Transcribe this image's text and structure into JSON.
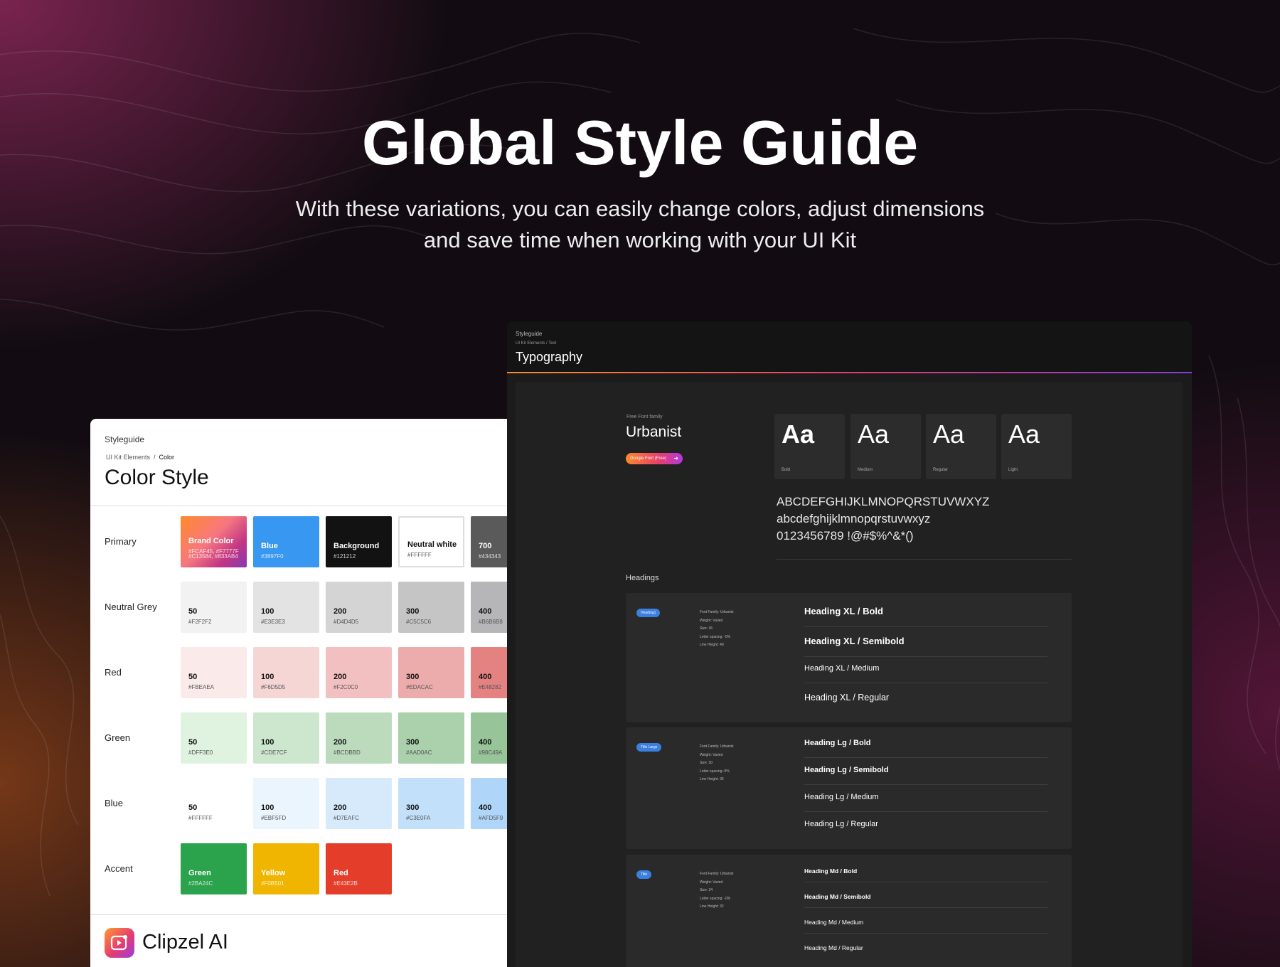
{
  "hero": {
    "title": "Global Style Guide",
    "subtitle_line1": "With these variations, you can easily change colors, adjust dimensions",
    "subtitle_line2": "and save time when working with your UI Kit"
  },
  "color_panel": {
    "crumb_top": "Styleguide",
    "breadcrumb_parent": "UI Kit Elements",
    "breadcrumb_sep": "/",
    "breadcrumb_current": "Color",
    "title": "Color Style",
    "rows": [
      {
        "label": "Primary",
        "swatches": [
          {
            "name": "Brand Color",
            "hex": "#FCAF45, #F7777F",
            "hex2": "#C13584, #833AB4",
            "bg": "gradient",
            "tone": "dark"
          },
          {
            "name": "Blue",
            "hex": "#3897F0",
            "bg": "#3897F0",
            "tone": "dark"
          },
          {
            "name": "Background",
            "hex": "#121212",
            "bg": "#121212",
            "tone": "dark"
          },
          {
            "name": "Neutral white",
            "hex": "#FFFFFF",
            "bg": "#FFFFFF",
            "tone": "lite",
            "border": true
          },
          {
            "name": "700",
            "hex": "#434343",
            "bg": "#5a5a5a",
            "tone": "dark"
          }
        ]
      },
      {
        "label": "Neutral Grey",
        "swatches": [
          {
            "name": "50",
            "hex": "#F2F2F2",
            "bg": "#F2F2F2",
            "tone": "lite"
          },
          {
            "name": "100",
            "hex": "#E3E3E3",
            "bg": "#E3E3E3",
            "tone": "lite"
          },
          {
            "name": "200",
            "hex": "#D4D4D5",
            "bg": "#D4D4D5",
            "tone": "lite"
          },
          {
            "name": "300",
            "hex": "#C5C5C6",
            "bg": "#C5C5C6",
            "tone": "lite"
          },
          {
            "name": "400",
            "hex": "#B6B6B8",
            "bg": "#B6B6B8",
            "tone": "lite"
          }
        ]
      },
      {
        "label": "Red",
        "swatches": [
          {
            "name": "50",
            "hex": "#FBEAEA",
            "bg": "#FBEAEA",
            "tone": "lite"
          },
          {
            "name": "100",
            "hex": "#F6D5D5",
            "bg": "#F6D5D5",
            "tone": "lite"
          },
          {
            "name": "200",
            "hex": "#F2C0C0",
            "bg": "#F2C0C0",
            "tone": "lite"
          },
          {
            "name": "300",
            "hex": "#EDACAC",
            "bg": "#EDACAC",
            "tone": "lite"
          },
          {
            "name": "400",
            "hex": "#E48282",
            "bg": "#E48282",
            "tone": "lite"
          }
        ]
      },
      {
        "label": "Green",
        "swatches": [
          {
            "name": "50",
            "hex": "#DFF3E0",
            "bg": "#DFF3E0",
            "tone": "lite"
          },
          {
            "name": "100",
            "hex": "#CDE7CF",
            "bg": "#CDE7CF",
            "tone": "lite"
          },
          {
            "name": "200",
            "hex": "#BCDBBD",
            "bg": "#BCDBBD",
            "tone": "lite"
          },
          {
            "name": "300",
            "hex": "#AAD0AC",
            "bg": "#AAD0AC",
            "tone": "lite"
          },
          {
            "name": "400",
            "hex": "#98C49A",
            "bg": "#98C49A",
            "tone": "lite"
          }
        ]
      },
      {
        "label": "Blue",
        "swatches": [
          {
            "name": "50",
            "hex": "#FFFFFF",
            "bg": "#FFFFFF",
            "tone": "lite"
          },
          {
            "name": "100",
            "hex": "#EBF5FD",
            "bg": "#EBF5FD",
            "tone": "lite"
          },
          {
            "name": "200",
            "hex": "#D7EAFC",
            "bg": "#D7EAFC",
            "tone": "lite"
          },
          {
            "name": "300",
            "hex": "#C3E0FA",
            "bg": "#C3E0FA",
            "tone": "lite"
          },
          {
            "name": "400",
            "hex": "#AFD5F9",
            "bg": "#AFD5F9",
            "tone": "lite"
          }
        ]
      },
      {
        "label": "Accent",
        "swatches": [
          {
            "name": "Green",
            "hex": "#2BA24C",
            "bg": "#2BA24C",
            "tone": "dark"
          },
          {
            "name": "Yellow",
            "hex": "#F0B501",
            "bg": "#F0B501",
            "tone": "dark"
          },
          {
            "name": "Red",
            "hex": "#E43E2B",
            "bg": "#E43E2B",
            "tone": "dark"
          }
        ]
      }
    ],
    "brand_name": "Clipzel AI",
    "brand_logo_icon": "play-video-icon"
  },
  "typo_panel": {
    "crumb_top": "Styleguide",
    "breadcrumb": "UI Kit Elements  /  Text",
    "title": "Typography",
    "font_family_label": "Free Font family",
    "font_name": "Urbanist",
    "font_badge": "Google Font (Free)",
    "weights": [
      {
        "sample": "Aa",
        "label": "Bold",
        "weight": "bold"
      },
      {
        "sample": "Aa",
        "label": "Medium",
        "weight": "normal"
      },
      {
        "sample": "Aa",
        "label": "Regular",
        "weight": "normal"
      },
      {
        "sample": "Aa",
        "label": "Light",
        "weight": "normal"
      }
    ],
    "alphabet_upper": "ABCDEFGHIJKLMNOPQRSTUVWXYZ",
    "alphabet_lower": "abcdefghijklmnopqrstuvwxyz",
    "digits": "0123456789 !@#$%^&*()",
    "headings_label": "Headings",
    "heading_groups": [
      {
        "badge": "Heading1",
        "meta": [
          "Font Family: Urbanist",
          "Weight: Varied",
          "Size: 36",
          "Letter spacing: -0%",
          "Line Height: 40"
        ],
        "styles": [
          "Heading XL / Bold",
          "Heading XL / Semibold",
          "Heading XL / Medium",
          "Heading XL / Regular"
        ]
      },
      {
        "badge": "Title Large",
        "meta": [
          "Font Family: Urbanist",
          "Weight: Varied",
          "Size: 30",
          "Letter spacing:-0%",
          "Line Height: 36"
        ],
        "styles": [
          "Heading Lg / Bold",
          "Heading Lg / Semibold",
          "Heading Lg / Medium",
          "Heading Lg / Regular"
        ]
      },
      {
        "badge": "Title",
        "meta": [
          "Font Family: Urbanist",
          "Weight: Varied",
          "Size: 24",
          "Letter spacing: -0%",
          "Line Height: 32"
        ],
        "styles": [
          "Heading Md / Bold",
          "Heading Md / Semibold",
          "Heading Md / Medium",
          "Heading Md / Regular"
        ]
      }
    ]
  },
  "colors": {
    "accent_gradient_start": "#FF8A2A",
    "accent_gradient_mid": "#E53C6F",
    "accent_gradient_end": "#8A3AE0",
    "badge_blue": "#3B7FE0"
  }
}
